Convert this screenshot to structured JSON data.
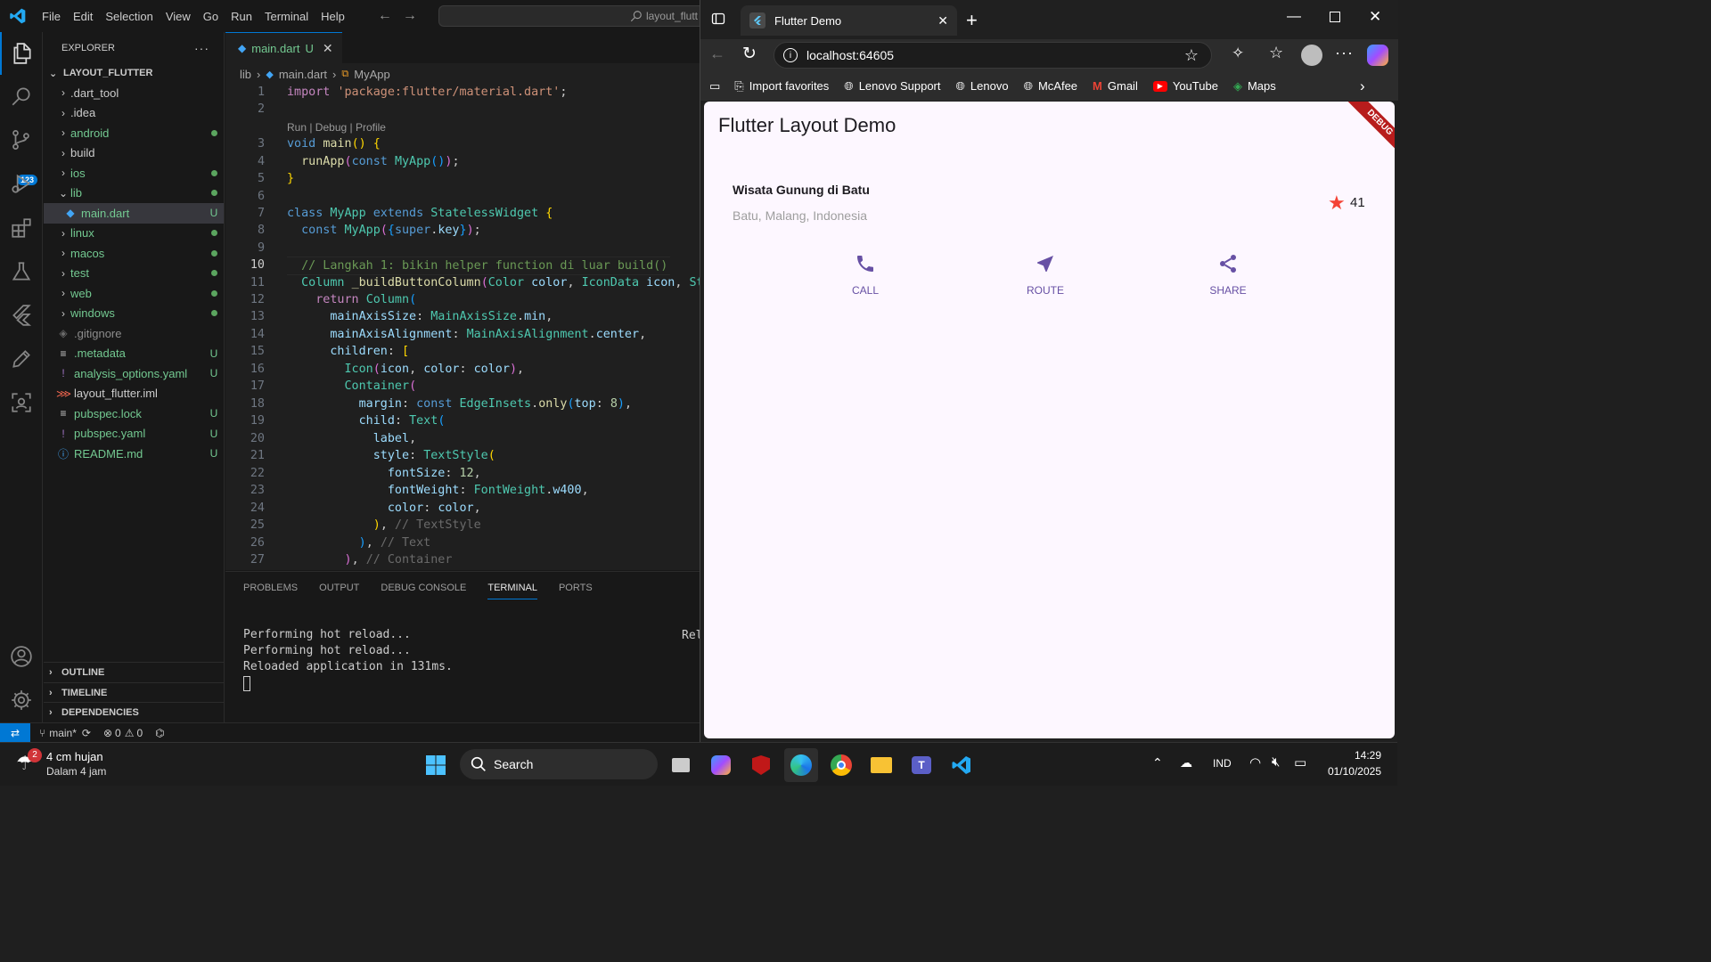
{
  "vscode": {
    "menu": [
      "File",
      "Edit",
      "Selection",
      "View",
      "Go",
      "Run",
      "Terminal",
      "Help"
    ],
    "command_center": "layout_flutt",
    "explorer_title": "EXPLORER",
    "project": "LAYOUT_FLUTTER",
    "tree": [
      {
        "name": ".dart_tool",
        "folder": true,
        "status": ""
      },
      {
        "name": ".idea",
        "folder": true,
        "status": ""
      },
      {
        "name": "android",
        "folder": true,
        "status": "dot"
      },
      {
        "name": "build",
        "folder": true,
        "status": ""
      },
      {
        "name": "ios",
        "folder": true,
        "status": "dot"
      },
      {
        "name": "lib",
        "folder": true,
        "status": "dot",
        "open": true
      },
      {
        "name": "main.dart",
        "folder": false,
        "status": "U",
        "selected": true,
        "indent": true
      },
      {
        "name": "linux",
        "folder": true,
        "status": "dot"
      },
      {
        "name": "macos",
        "folder": true,
        "status": "dot"
      },
      {
        "name": "test",
        "folder": true,
        "status": "dot"
      },
      {
        "name": "web",
        "folder": true,
        "status": "dot"
      },
      {
        "name": "windows",
        "folder": true,
        "status": "dot"
      },
      {
        "name": ".gitignore",
        "folder": false,
        "status": ""
      },
      {
        "name": ".metadata",
        "folder": false,
        "status": "U"
      },
      {
        "name": "analysis_options.yaml",
        "folder": false,
        "status": "U"
      },
      {
        "name": "layout_flutter.iml",
        "folder": false,
        "status": ""
      },
      {
        "name": "pubspec.lock",
        "folder": false,
        "status": "U"
      },
      {
        "name": "pubspec.yaml",
        "folder": false,
        "status": "U"
      },
      {
        "name": "README.md",
        "folder": false,
        "status": "U"
      }
    ],
    "sections": [
      "OUTLINE",
      "TIMELINE",
      "DEPENDENCIES"
    ],
    "tab": {
      "name": "main.dart",
      "status": "U"
    },
    "breadcrumb": [
      "lib",
      "main.dart",
      "MyApp"
    ],
    "codelens": "Run | Debug | Profile",
    "line_numbers": [
      "1",
      "2",
      "3",
      "4",
      "5",
      "6",
      "7",
      "8",
      "9",
      "10",
      "11",
      "12",
      "13",
      "14",
      "15",
      "16",
      "17",
      "18",
      "19",
      "20",
      "21",
      "22",
      "23",
      "24",
      "25",
      "26",
      "27"
    ],
    "current_line": "10",
    "panel_tabs": [
      "PROBLEMS",
      "OUTPUT",
      "DEBUG CONSOLE",
      "TERMINAL",
      "PORTS"
    ],
    "active_panel_tab": "TERMINAL",
    "terminal": [
      "Performing hot reload...",
      "Performing hot reload...",
      "Reloaded application in 131ms."
    ],
    "terminal_right": "Rel",
    "status": {
      "branch": "main*",
      "errors": "0",
      "warnings": "0"
    },
    "scm_badge": "123"
  },
  "browser": {
    "tab_title": "Flutter Demo",
    "url": "localhost:64605",
    "favorites": [
      "Import favorites",
      "Lenovo Support",
      "Lenovo",
      "McAfee",
      "Gmail",
      "YouTube",
      "Maps"
    ]
  },
  "app": {
    "title": "Flutter Layout Demo",
    "debug_banner": "DEBUG",
    "place_title": "Wisata Gunung di Batu",
    "place_subtitle": "Batu, Malang, Indonesia",
    "rating": "41",
    "buttons": [
      {
        "label": "CALL",
        "icon": "phone-icon"
      },
      {
        "label": "ROUTE",
        "icon": "navigation-icon"
      },
      {
        "label": "SHARE",
        "icon": "share-icon"
      }
    ],
    "accent": "#6750a4",
    "star_color": "#f44336"
  },
  "taskbar": {
    "weather_badge": "2",
    "weather_line1": "4 cm hujan",
    "weather_line2": "Dalam 4 jam",
    "search": "Search",
    "lang": "IND",
    "time": "14:29",
    "date": "01/10/2025"
  }
}
